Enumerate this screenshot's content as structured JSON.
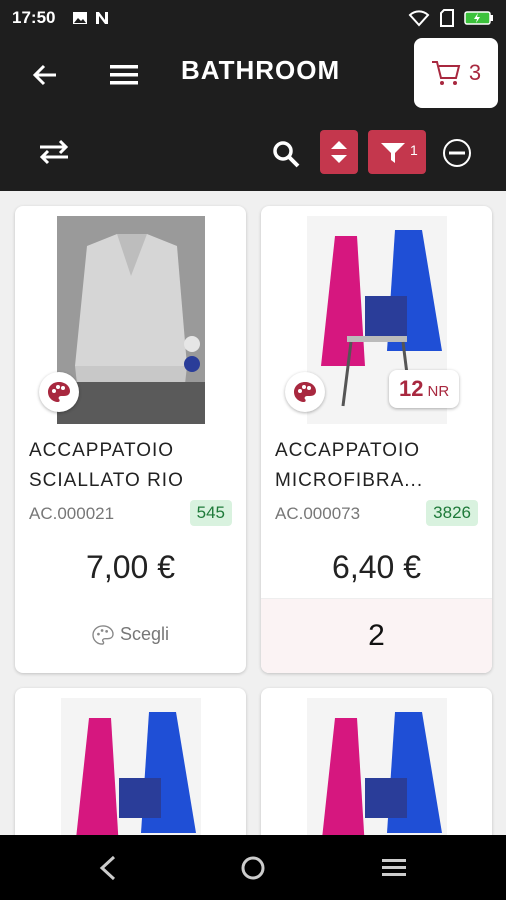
{
  "status": {
    "time": "17:50"
  },
  "header": {
    "title": "BATHROOM",
    "cart_count": "3",
    "filter_count": "1"
  },
  "colors": {
    "accent": "#c4374d",
    "dark": "#1e1e1e",
    "stock_bg": "#d9f2df"
  },
  "products": [
    {
      "name": "ACCAPPATOIO SCIALLATO RIO",
      "code": "AC.000021",
      "stock": "545",
      "price": "7,00 €",
      "action": "Scegli"
    },
    {
      "name": "ACCAPPATOIO MICROFIBRA...",
      "code": "AC.000073",
      "stock": "3826",
      "price": "6,40 €",
      "qty_badge_value": "12",
      "qty_badge_unit": "NR",
      "quantity": "2"
    }
  ],
  "icons": [
    "back-arrow-icon",
    "menu-icon",
    "swap-icon",
    "search-icon",
    "sort-icon",
    "filter-icon",
    "minus-circle-icon",
    "cart-icon",
    "palette-icon"
  ]
}
